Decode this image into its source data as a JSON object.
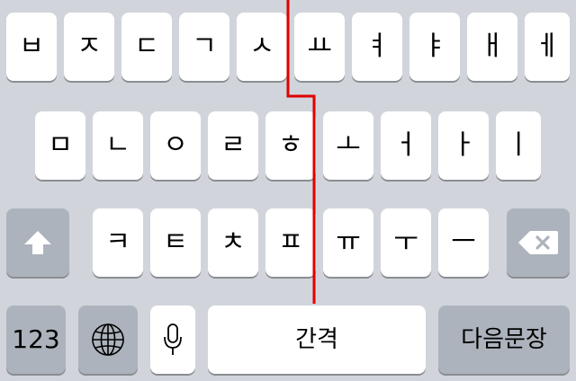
{
  "keyboard": {
    "row1": [
      "ㅂ",
      "ㅈ",
      "ㄷ",
      "ㄱ",
      "ㅅ",
      "ㅛ",
      "ㅕ",
      "ㅑ",
      "ㅐ",
      "ㅔ"
    ],
    "row2": [
      "ㅁ",
      "ㄴ",
      "ㅇ",
      "ㄹ",
      "ㅎ",
      "ㅗ",
      "ㅓ",
      "ㅏ",
      "ㅣ"
    ],
    "row3": [
      "ㅋ",
      "ㅌ",
      "ㅊ",
      "ㅍ",
      "ㅠ",
      "ㅜ",
      "ㅡ"
    ],
    "shift_icon": "shift-arrow-icon",
    "delete_icon": "backspace-icon",
    "numbers_label": "123",
    "globe_icon": "globe-icon",
    "mic_icon": "microphone-icon",
    "space_label": "간격",
    "return_label": "다음문장"
  },
  "colors": {
    "background": "#d1d5db",
    "key": "#ffffff",
    "function_key": "#acb3bc",
    "divider_line": "#e00000"
  }
}
